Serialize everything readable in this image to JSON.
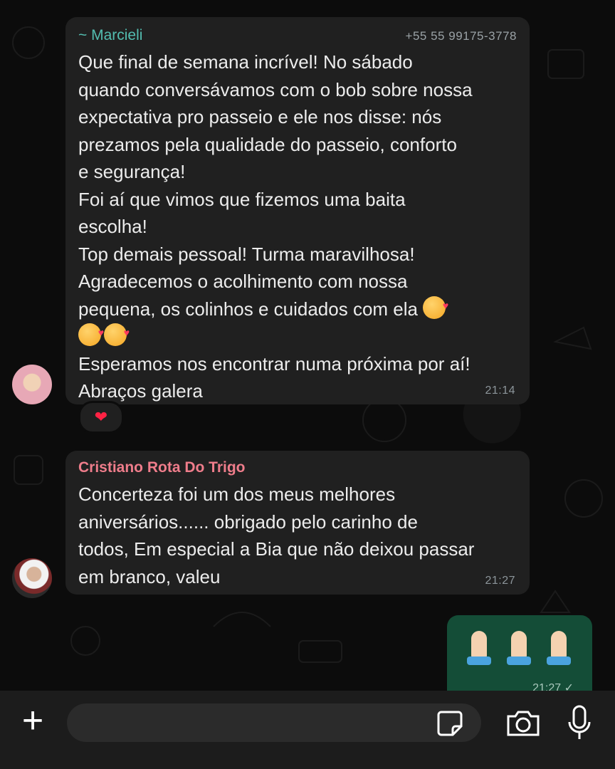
{
  "chat": {
    "messages": [
      {
        "sender": "~ Marcieli",
        "phone": "+55 55 99175-3778",
        "text": "Que final de semana incrível! No sábado\nquando conversávamos com o bob sobre nossa\nexpectativa pro passeio e ele nos disse: nós\nprezamos pela qualidade do passeio, conforto\ne segurança!\nFoi aí que vimos que fizemos uma baita\nescolha!\nTop demais pessoal! Turma maravilhosa!\nAgradecemos o acolhimento com nossa\npequena, os colinhos e cuidados com ela",
        "text_after": "Esperamos nos encontrar numa próxima por aí!\nAbraços galera",
        "time": "21:14",
        "reaction": "❤"
      },
      {
        "sender": "Cristiano Rota Do Trigo",
        "text": "Concerteza foi um dos meus melhores\naniversários...... obrigado pelo carinho de\ntodos, Em especial a Bia que não deixou passar\nem branco, valeu",
        "time": "21:27"
      },
      {
        "time": "21:27 ✓"
      }
    ]
  },
  "composer": {
    "plus_label": "+",
    "input_value": ""
  },
  "colors": {
    "incoming_bubble": "#202020",
    "outgoing_bubble": "#144d37",
    "sender1": "#53bdb0",
    "sender2": "#ef7d8b"
  },
  "icons": [
    "plus-icon",
    "sticker-icon",
    "camera-icon",
    "mic-icon",
    "heart-reaction-icon",
    "smiling-face-hearts-emoji",
    "folded-hands-emoji"
  ]
}
